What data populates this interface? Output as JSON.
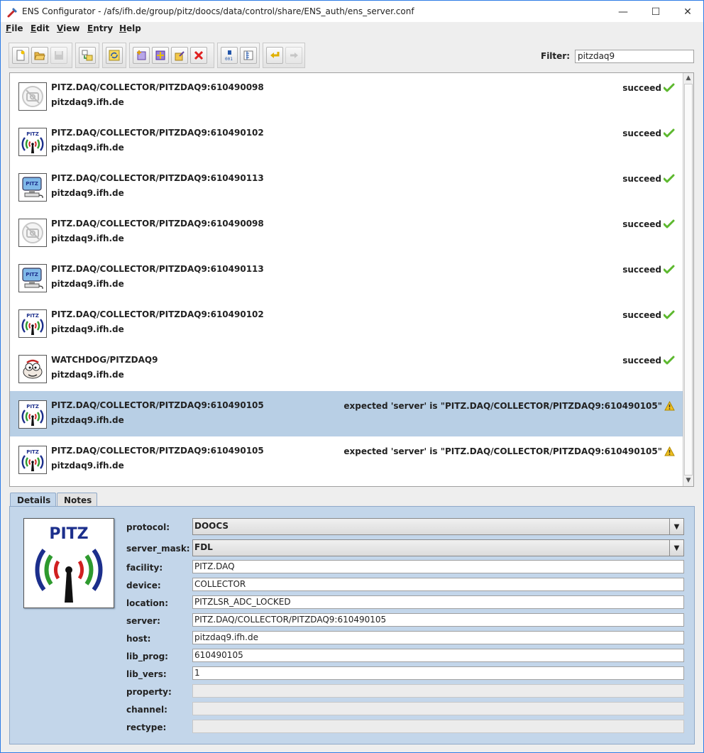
{
  "window": {
    "title": "ENS Configurator - /afs/ifh.de/group/pitz/doocs/data/control/share/ENS_auth/ens_server.conf",
    "minimize": "—",
    "maximize": "☐",
    "close": "✕"
  },
  "menu": [
    {
      "label": "File",
      "mnemonic": "F",
      "rest": "ile"
    },
    {
      "label": "Edit",
      "mnemonic": "E",
      "rest": "dit"
    },
    {
      "label": "View",
      "mnemonic": "V",
      "rest": "iew"
    },
    {
      "label": "Entry",
      "mnemonic": "E",
      "rest": "ntry"
    },
    {
      "label": "Help",
      "mnemonic": "H",
      "rest": "elp"
    }
  ],
  "toolbar": {
    "buttons": [
      "new-file-icon",
      "open-folder-icon",
      "save-icon",
      "import-icon",
      "refresh-icon",
      "add-entry-icon",
      "add-multiple-icon",
      "edit-entry-icon",
      "delete-icon",
      "number-icon",
      "columns-icon",
      "undo-icon",
      "redo-icon"
    ]
  },
  "filter": {
    "label": "Filter:",
    "value": "pitzdaq9"
  },
  "entries": [
    {
      "name": "PITZ.DAQ/COLLECTOR/PITZDAQ9:610490098",
      "host": "pitzdaq9.ifh.de",
      "status": "succeed",
      "status_type": "ok",
      "icon": "no-camera-icon",
      "selected": false
    },
    {
      "name": "PITZ.DAQ/COLLECTOR/PITZDAQ9:610490102",
      "host": "pitzdaq9.ifh.de",
      "status": "succeed",
      "status_type": "ok",
      "icon": "pitz-antenna-icon",
      "selected": false
    },
    {
      "name": "PITZ.DAQ/COLLECTOR/PITZDAQ9:610490113",
      "host": "pitzdaq9.ifh.de",
      "status": "succeed",
      "status_type": "ok",
      "icon": "pitz-computer-icon",
      "selected": false
    },
    {
      "name": "PITZ.DAQ/COLLECTOR/PITZDAQ9:610490098",
      "host": "pitzdaq9.ifh.de",
      "status": "succeed",
      "status_type": "ok",
      "icon": "no-camera-icon",
      "selected": false
    },
    {
      "name": "PITZ.DAQ/COLLECTOR/PITZDAQ9:610490113",
      "host": "pitzdaq9.ifh.de",
      "status": "succeed",
      "status_type": "ok",
      "icon": "pitz-computer-icon",
      "selected": false
    },
    {
      "name": "PITZ.DAQ/COLLECTOR/PITZDAQ9:610490102",
      "host": "pitzdaq9.ifh.de",
      "status": "succeed",
      "status_type": "ok",
      "icon": "pitz-antenna-icon",
      "selected": false
    },
    {
      "name": "WATCHDOG/PITZDAQ9",
      "host": "pitzdaq9.ifh.de",
      "status": "succeed",
      "status_type": "ok",
      "icon": "watchdog-icon",
      "selected": false
    },
    {
      "name": "PITZ.DAQ/COLLECTOR/PITZDAQ9:610490105",
      "host": "pitzdaq9.ifh.de",
      "status": "expected 'server' is \"PITZ.DAQ/COLLECTOR/PITZDAQ9:610490105\"",
      "status_type": "warn",
      "icon": "pitz-antenna-icon",
      "selected": true
    },
    {
      "name": "PITZ.DAQ/COLLECTOR/PITZDAQ9:610490105",
      "host": "pitzdaq9.ifh.de",
      "status": "expected 'server' is \"PITZ.DAQ/COLLECTOR/PITZDAQ9:610490105\"",
      "status_type": "warn",
      "icon": "pitz-antenna-icon",
      "selected": false
    }
  ],
  "tabs": {
    "details": "Details",
    "notes": "Notes"
  },
  "details": {
    "logo_text": "PITZ",
    "protocol": {
      "label": "protocol:",
      "value": "DOOCS"
    },
    "server_mask": {
      "label": "server_mask:",
      "value": "FDL"
    },
    "facility": {
      "label": "facility:",
      "value": "PITZ.DAQ"
    },
    "device": {
      "label": "device:",
      "value": "COLLECTOR"
    },
    "location": {
      "label": "location:",
      "value": "PITZLSR_ADC_LOCKED"
    },
    "server": {
      "label": "server:",
      "value": "PITZ.DAQ/COLLECTOR/PITZDAQ9:610490105"
    },
    "host": {
      "label": "host:",
      "value": "pitzdaq9.ifh.de"
    },
    "lib_prog": {
      "label": "lib_prog:",
      "value": "610490105"
    },
    "lib_vers": {
      "label": "lib_vers:",
      "value": "1"
    },
    "property": {
      "label": "property:",
      "value": ""
    },
    "channel": {
      "label": "channel:",
      "value": ""
    },
    "rectype": {
      "label": "rectype:",
      "value": ""
    }
  },
  "colors": {
    "selection": "#b8cfe5",
    "panel": "#c3d6ea",
    "ok": "#5cb82e",
    "warn": "#f0c020",
    "frame": "#2e7ce5"
  }
}
